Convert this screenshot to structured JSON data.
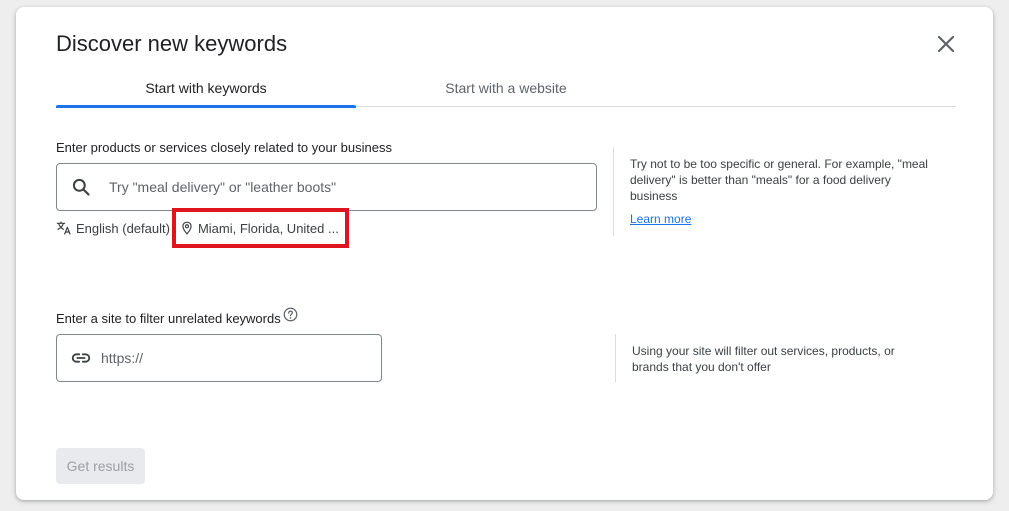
{
  "dialog": {
    "title": "Discover new keywords"
  },
  "tabs": [
    {
      "label": "Start with keywords",
      "active": true
    },
    {
      "label": "Start with a website",
      "active": false
    }
  ],
  "keywords_section": {
    "label": "Enter products or services closely related to your business",
    "input_placeholder": "Try \"meal delivery\" or \"leather boots\"",
    "input_value": "",
    "language": "English (default)",
    "location": "Miami, Florida, United ...",
    "tip": "Try not to be too specific or general. For example, \"meal delivery\" is better than \"meals\" for a food delivery business",
    "learn_more": "Learn more"
  },
  "site_section": {
    "label": "Enter a site to filter unrelated keywords",
    "input_placeholder": "https://",
    "input_value": "",
    "tip": "Using your site will filter out services, products, or brands that you don't offer"
  },
  "actions": {
    "get_results": "Get results"
  },
  "icons": {
    "search": "search-icon",
    "translate": "translate-icon",
    "location": "location-pin-icon",
    "link": "link-icon",
    "help": "help-circle-icon",
    "close": "close-icon"
  },
  "colors": {
    "accent": "#1a73e8",
    "highlight": "#e0141e",
    "disabled_bg": "#e8eaed",
    "disabled_text": "#9aa0a6"
  }
}
